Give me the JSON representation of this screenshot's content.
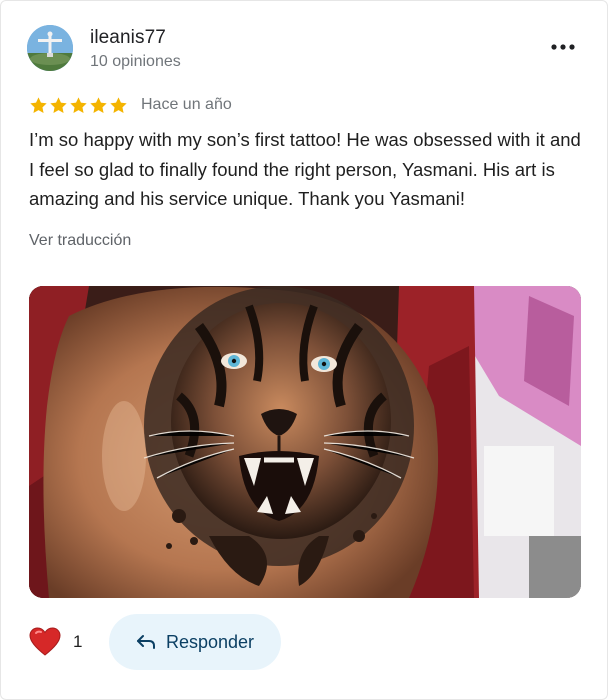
{
  "review": {
    "user": {
      "name": "ileanis77",
      "reviews_count": "10 opiniones",
      "avatar_icon": "statue-avatar"
    },
    "rating": 5,
    "rating_max": 5,
    "star_color": "#f4b400",
    "date": "Hace un año",
    "text": "I’m so happy with my son’s first tattoo! He was obsessed with it and I feel so glad to finally found the right person, Yasmani. His art is amazing and his service unique. Thank you Yasmani!",
    "translate_label": "Ver traducción",
    "photo_icon": "tiger-tattoo-photo"
  },
  "actions": {
    "like_icon": "heart-icon",
    "like_count": "1",
    "reply_icon": "reply-arrow-icon",
    "reply_label": "Responder",
    "more_icon": "more-dots-icon"
  }
}
